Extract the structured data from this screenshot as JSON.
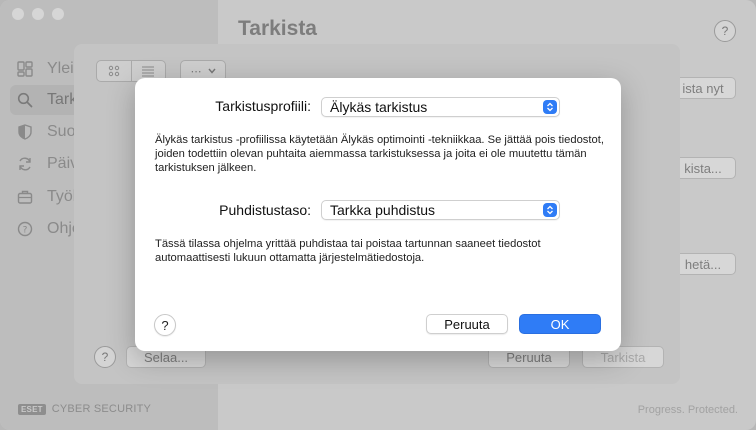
{
  "sidebar": {
    "items": [
      {
        "label": "Yleis",
        "icon": "overview-icon"
      },
      {
        "label": "Tark",
        "icon": "search-icon"
      },
      {
        "label": "Suo",
        "icon": "shield-icon"
      },
      {
        "label": "Päiv",
        "icon": "refresh-icon"
      },
      {
        "label": "Työl",
        "icon": "briefcase-icon"
      },
      {
        "label": "Ohje",
        "icon": "help-icon"
      }
    ],
    "brand_badge": "ESET",
    "brand_text": "CYBER SECURITY"
  },
  "main": {
    "title": "Tarkista",
    "help": "?",
    "right_buttons": [
      "ista nyt",
      "kista...",
      "hetä..."
    ],
    "footer_tag": "Progress. Protected."
  },
  "sheet": {
    "more": "⋯",
    "help": "?",
    "browse": "Selaa...",
    "cancel": "Peruuta",
    "scan": "Tarkista"
  },
  "dialog": {
    "profile_label": "Tarkistusprofiili:",
    "profile_value": "Älykäs tarkistus",
    "profile_desc": "Älykäs tarkistus -profiilissa käytetään Älykäs optimointi -tekniikkaa. Se jättää pois tiedostot, joiden todettiin olevan puhtaita aiemmassa tarkistuksessa ja joita ei ole muutettu tämän tarkistuksen jälkeen.",
    "clean_label": "Puhdistustaso:",
    "clean_value": "Tarkka puhdistus",
    "clean_desc": "Tässä tilassa ohjelma yrittää puhdistaa tai poistaa tartunnan saaneet tiedostot automaattisesti lukuun ottamatta järjestelmätiedostoja.",
    "help": "?",
    "cancel": "Peruuta",
    "ok": "OK"
  },
  "colors": {
    "accent": "#2f7cf6"
  }
}
